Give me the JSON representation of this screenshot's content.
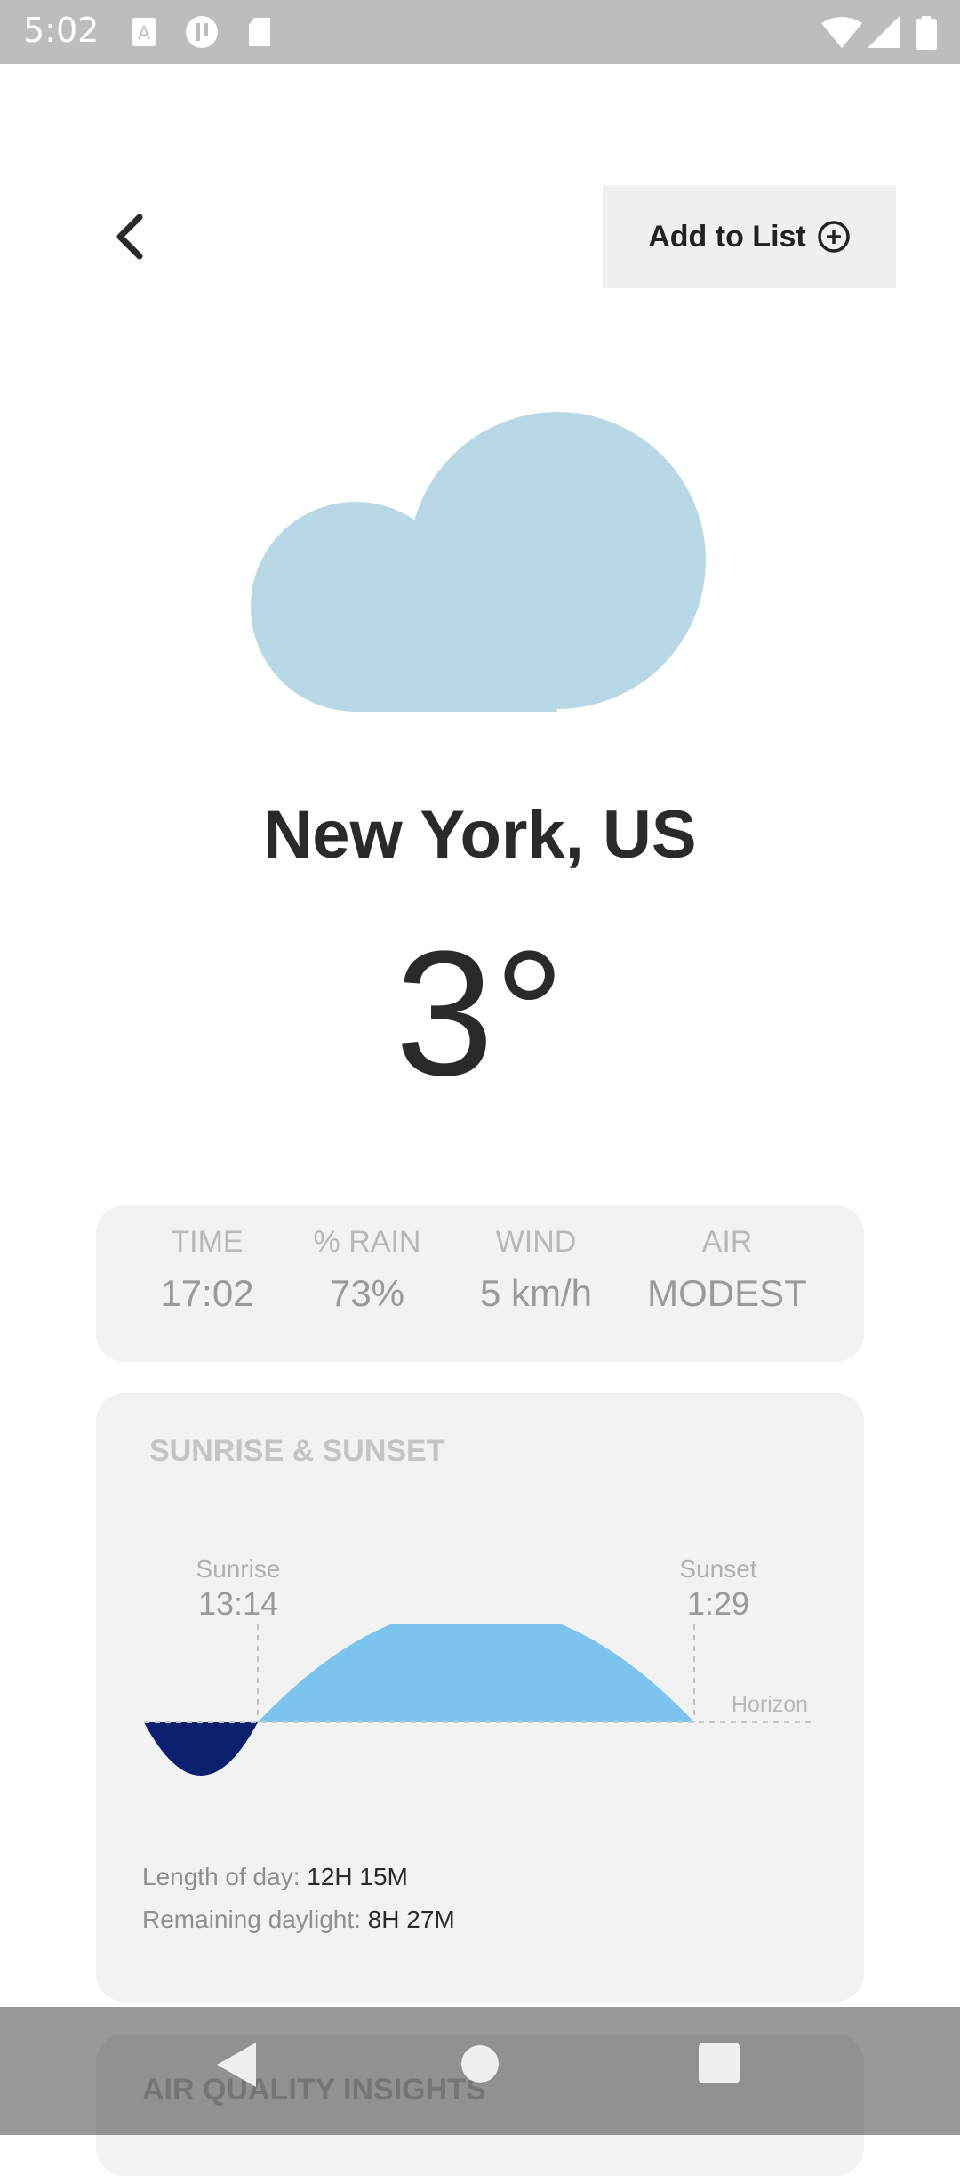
{
  "status_bar": {
    "time": "5:02"
  },
  "header": {
    "add_label": "Add to List"
  },
  "weather": {
    "city": "New York, US",
    "temperature": "3°",
    "cloud_color": "#b9d8e6"
  },
  "stats": [
    {
      "label": "TIME",
      "value": "17:02"
    },
    {
      "label": "% RAIN",
      "value": "73%"
    },
    {
      "label": "WIND",
      "value": "5 km/h"
    },
    {
      "label": "AIR",
      "value": "MODEST"
    }
  ],
  "sun": {
    "title": "SUNRISE & SUNSET",
    "sunrise_label": "Sunrise",
    "sunrise_time": "13:14",
    "sunset_label": "Sunset",
    "sunset_time": "1:29",
    "horizon_label": "Horizon",
    "length_label": "Length of day:",
    "length_value": "12H 15M",
    "remaining_label": "Remaining daylight:",
    "remaining_value": "8H 27M",
    "day_color": "#7cc4ee",
    "night_color": "#0a1f6e"
  },
  "air_quality": {
    "title": "AIR QUALITY INSIGHTS"
  },
  "nav": {
    "back": "back-icon",
    "home": "home-icon",
    "recents": "recents-icon"
  }
}
